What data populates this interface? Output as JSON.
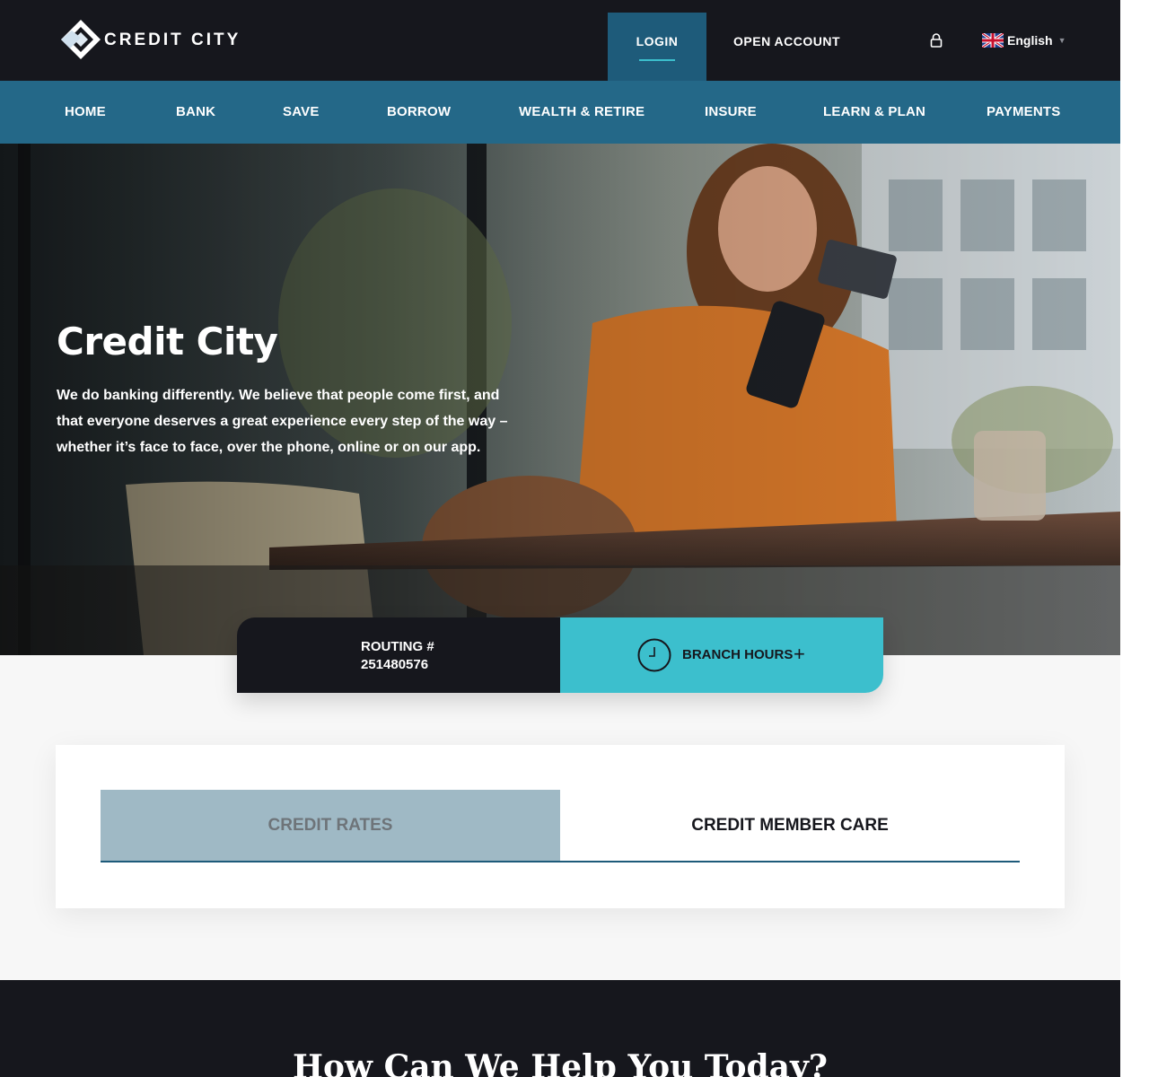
{
  "brand": {
    "name": "CREDIT CITY"
  },
  "header": {
    "login_label": "LOGIN",
    "open_account_label": "OPEN ACCOUNT",
    "language": "English"
  },
  "nav": {
    "items": [
      "HOME",
      "BANK",
      "SAVE",
      "BORROW",
      "WEALTH & RETIRE",
      "INSURE",
      "LEARN & PLAN",
      "PAYMENTS"
    ]
  },
  "hero": {
    "title": "Credit City",
    "text": "We do banking differently. We believe that people come first, and that everyone deserves a great experience every step of the way – whether it’s face to face, over the phone, online or on our app."
  },
  "infobar": {
    "routing_label": "ROUTING #",
    "routing_number": "251480576",
    "branch_hours_label": "BRANCH HOURS"
  },
  "tabs": {
    "rates_label": "CREDIT RATES",
    "care_label": "CREDIT MEMBER CARE"
  },
  "help": {
    "title": "How Can We Help You Today?"
  },
  "colors": {
    "dark": "#16171d",
    "primary_blue": "#1e5b7a",
    "teal": "#3cbfcd",
    "tab_gray_blue": "#9fb9c5"
  },
  "icons": {
    "logo": "diamond-logo-icon",
    "lock": "lock-icon",
    "flag": "uk-flag-icon",
    "clock": "clock-icon",
    "plus": "plus-icon"
  }
}
